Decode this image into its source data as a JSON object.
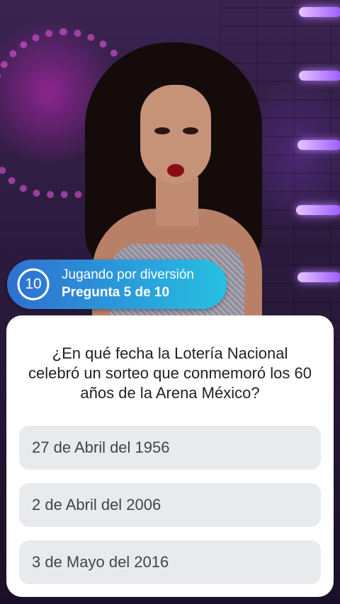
{
  "status": {
    "timer_value": "10",
    "mode_text": "Jugando por diversión",
    "progress_text": "Pregunta 5 de 10",
    "progress_fraction": 0.5
  },
  "quiz": {
    "question": "¿En qué fecha la Lotería Nacional celebró un sorteo que conmemoró los 60 años de la Arena México?",
    "answers": [
      {
        "label": "27 de Abril del 1956"
      },
      {
        "label": "2 de Abril del 2006"
      },
      {
        "label": "3 de Mayo del 2016"
      }
    ]
  },
  "colors": {
    "status_gradient_start": "#2f6fd0",
    "status_gradient_end": "#26c0e0",
    "answer_bg": "#e8eaed",
    "card_bg": "#ffffff"
  },
  "icons": {
    "timer": "countdown-ring-icon"
  }
}
